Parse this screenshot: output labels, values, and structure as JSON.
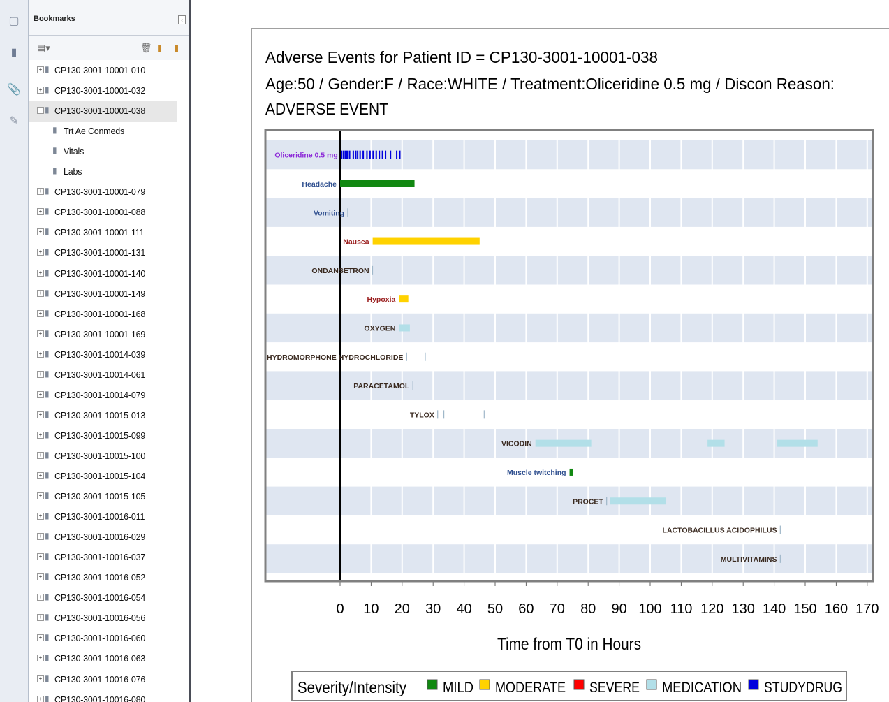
{
  "sidebar": {
    "panel_title": "Bookmarks",
    "items": [
      {
        "label": "CP130-3001-10001-010",
        "expand": "+"
      },
      {
        "label": "CP130-3001-10001-032",
        "expand": "+"
      },
      {
        "label": "CP130-3001-10001-038",
        "expand": "−",
        "selected": true
      },
      {
        "label": "Trt Ae Conmeds",
        "child": true
      },
      {
        "label": "Vitals",
        "child": true
      },
      {
        "label": "Labs",
        "child": true
      },
      {
        "label": "CP130-3001-10001-079",
        "expand": "+"
      },
      {
        "label": "CP130-3001-10001-088",
        "expand": "+"
      },
      {
        "label": "CP130-3001-10001-111",
        "expand": "+"
      },
      {
        "label": "CP130-3001-10001-131",
        "expand": "+"
      },
      {
        "label": "CP130-3001-10001-140",
        "expand": "+"
      },
      {
        "label": "CP130-3001-10001-149",
        "expand": "+"
      },
      {
        "label": "CP130-3001-10001-168",
        "expand": "+"
      },
      {
        "label": "CP130-3001-10001-169",
        "expand": "+"
      },
      {
        "label": "CP130-3001-10014-039",
        "expand": "+"
      },
      {
        "label": "CP130-3001-10014-061",
        "expand": "+"
      },
      {
        "label": "CP130-3001-10014-079",
        "expand": "+"
      },
      {
        "label": "CP130-3001-10015-013",
        "expand": "+"
      },
      {
        "label": "CP130-3001-10015-099",
        "expand": "+"
      },
      {
        "label": "CP130-3001-10015-100",
        "expand": "+"
      },
      {
        "label": "CP130-3001-10015-104",
        "expand": "+"
      },
      {
        "label": "CP130-3001-10015-105",
        "expand": "+"
      },
      {
        "label": "CP130-3001-10016-011",
        "expand": "+"
      },
      {
        "label": "CP130-3001-10016-029",
        "expand": "+"
      },
      {
        "label": "CP130-3001-10016-037",
        "expand": "+"
      },
      {
        "label": "CP130-3001-10016-052",
        "expand": "+"
      },
      {
        "label": "CP130-3001-10016-054",
        "expand": "+"
      },
      {
        "label": "CP130-3001-10016-056",
        "expand": "+"
      },
      {
        "label": "CP130-3001-10016-060",
        "expand": "+"
      },
      {
        "label": "CP130-3001-10016-063",
        "expand": "+"
      },
      {
        "label": "CP130-3001-10016-076",
        "expand": "+"
      },
      {
        "label": "CP130-3001-10016-080",
        "expand": "+"
      }
    ]
  },
  "chart_data": {
    "type": "timeline",
    "title_lines": [
      "Adverse Events for Patient ID = CP130-3001-10001-038",
      "Age:50 /  Gender:F / Race:WHITE / Treatment:Oliceridine 0.5 mg / Discon Reason:",
      "ADVERSE EVENT"
    ],
    "xlabel": "Time from T0 in Hours",
    "xlim": [
      -24,
      172
    ],
    "xticks": [
      0,
      10,
      20,
      30,
      40,
      50,
      60,
      70,
      80,
      90,
      100,
      110,
      120,
      130,
      140,
      150,
      160,
      170
    ],
    "colors": {
      "MILD": "#118811",
      "MODERATE": "#ffd200",
      "SEVERE": "#ff0000",
      "MEDICATION": "#b2dfe8",
      "STUDYDRUG": "#0000dd"
    },
    "label_colors": {
      "drug": "#8c28d8",
      "ae": "#2f4f8f",
      "moderate_ae": "#9b2020",
      "med": "#3a2a20"
    },
    "legend": {
      "title": "Severity/Intensity",
      "items": [
        {
          "name": "MILD",
          "color": "#118811"
        },
        {
          "name": "MODERATE",
          "color": "#ffd200"
        },
        {
          "name": "SEVERE",
          "color": "#ff0000"
        },
        {
          "name": "MEDICATION",
          "color": "#b2dfe8"
        },
        {
          "name": "STUDYDRUG",
          "color": "#0000dd"
        }
      ]
    },
    "rows": [
      {
        "label": "Oliceridine 0.5 mg",
        "kind": "drug",
        "segments": [],
        "ticks": [
          0.4,
          1.0,
          1.6,
          2.2,
          3.0,
          4.2,
          5.0,
          5.6,
          6.4,
          7.4,
          8.6,
          9.6,
          10.6,
          11.6,
          12.6,
          13.6,
          14.6,
          16.2,
          18.2,
          19.2
        ]
      },
      {
        "label": "Headache",
        "kind": "ae",
        "segments": [
          {
            "start": 0,
            "end": 24,
            "cat": "MILD"
          }
        ],
        "ticks": []
      },
      {
        "label": "Vomiting",
        "kind": "ae",
        "segments": [],
        "ticks": [
          2.5
        ]
      },
      {
        "label": "Nausea",
        "kind": "moderate_ae",
        "segments": [
          {
            "start": 10.5,
            "end": 45,
            "cat": "MODERATE"
          }
        ],
        "ticks": []
      },
      {
        "label": "ONDANSETRON",
        "kind": "med",
        "segments": [],
        "ticks": [
          10.5
        ]
      },
      {
        "label": "Hypoxia",
        "kind": "moderate_ae",
        "segments": [
          {
            "start": 19,
            "end": 22,
            "cat": "MODERATE"
          }
        ],
        "ticks": []
      },
      {
        "label": "OXYGEN",
        "kind": "med",
        "segments": [
          {
            "start": 19,
            "end": 22.5,
            "cat": "MEDICATION"
          }
        ],
        "ticks": []
      },
      {
        "label": "HYDROMORPHONE HYDROCHLORIDE",
        "kind": "med",
        "segments": [],
        "ticks": [
          21.5,
          27.5
        ]
      },
      {
        "label": "PARACETAMOL",
        "kind": "med",
        "segments": [],
        "ticks": [
          23.5
        ]
      },
      {
        "label": "TYLOX",
        "kind": "med",
        "segments": [],
        "ticks": [
          31.5,
          33.5,
          46.5
        ]
      },
      {
        "label": "VICODIN",
        "kind": "med",
        "segments": [
          {
            "start": 63,
            "end": 81,
            "cat": "MEDICATION"
          },
          {
            "start": 118.5,
            "end": 124,
            "cat": "MEDICATION"
          },
          {
            "start": 141,
            "end": 154,
            "cat": "MEDICATION"
          }
        ],
        "ticks": []
      },
      {
        "label": "Muscle twitching",
        "kind": "ae",
        "segments": [
          {
            "start": 74,
            "end": 75,
            "cat": "MILD"
          }
        ],
        "ticks": []
      },
      {
        "label": "PROCET",
        "kind": "med",
        "segments": [
          {
            "start": 87,
            "end": 105,
            "cat": "MEDICATION"
          }
        ],
        "ticks": [
          86
        ]
      },
      {
        "label": "LACTOBACILLUS ACIDOPHILUS",
        "kind": "med",
        "segments": [],
        "ticks": [
          142
        ]
      },
      {
        "label": "MULTIVITAMINS",
        "kind": "med",
        "segments": [],
        "ticks": [
          142
        ]
      }
    ]
  }
}
